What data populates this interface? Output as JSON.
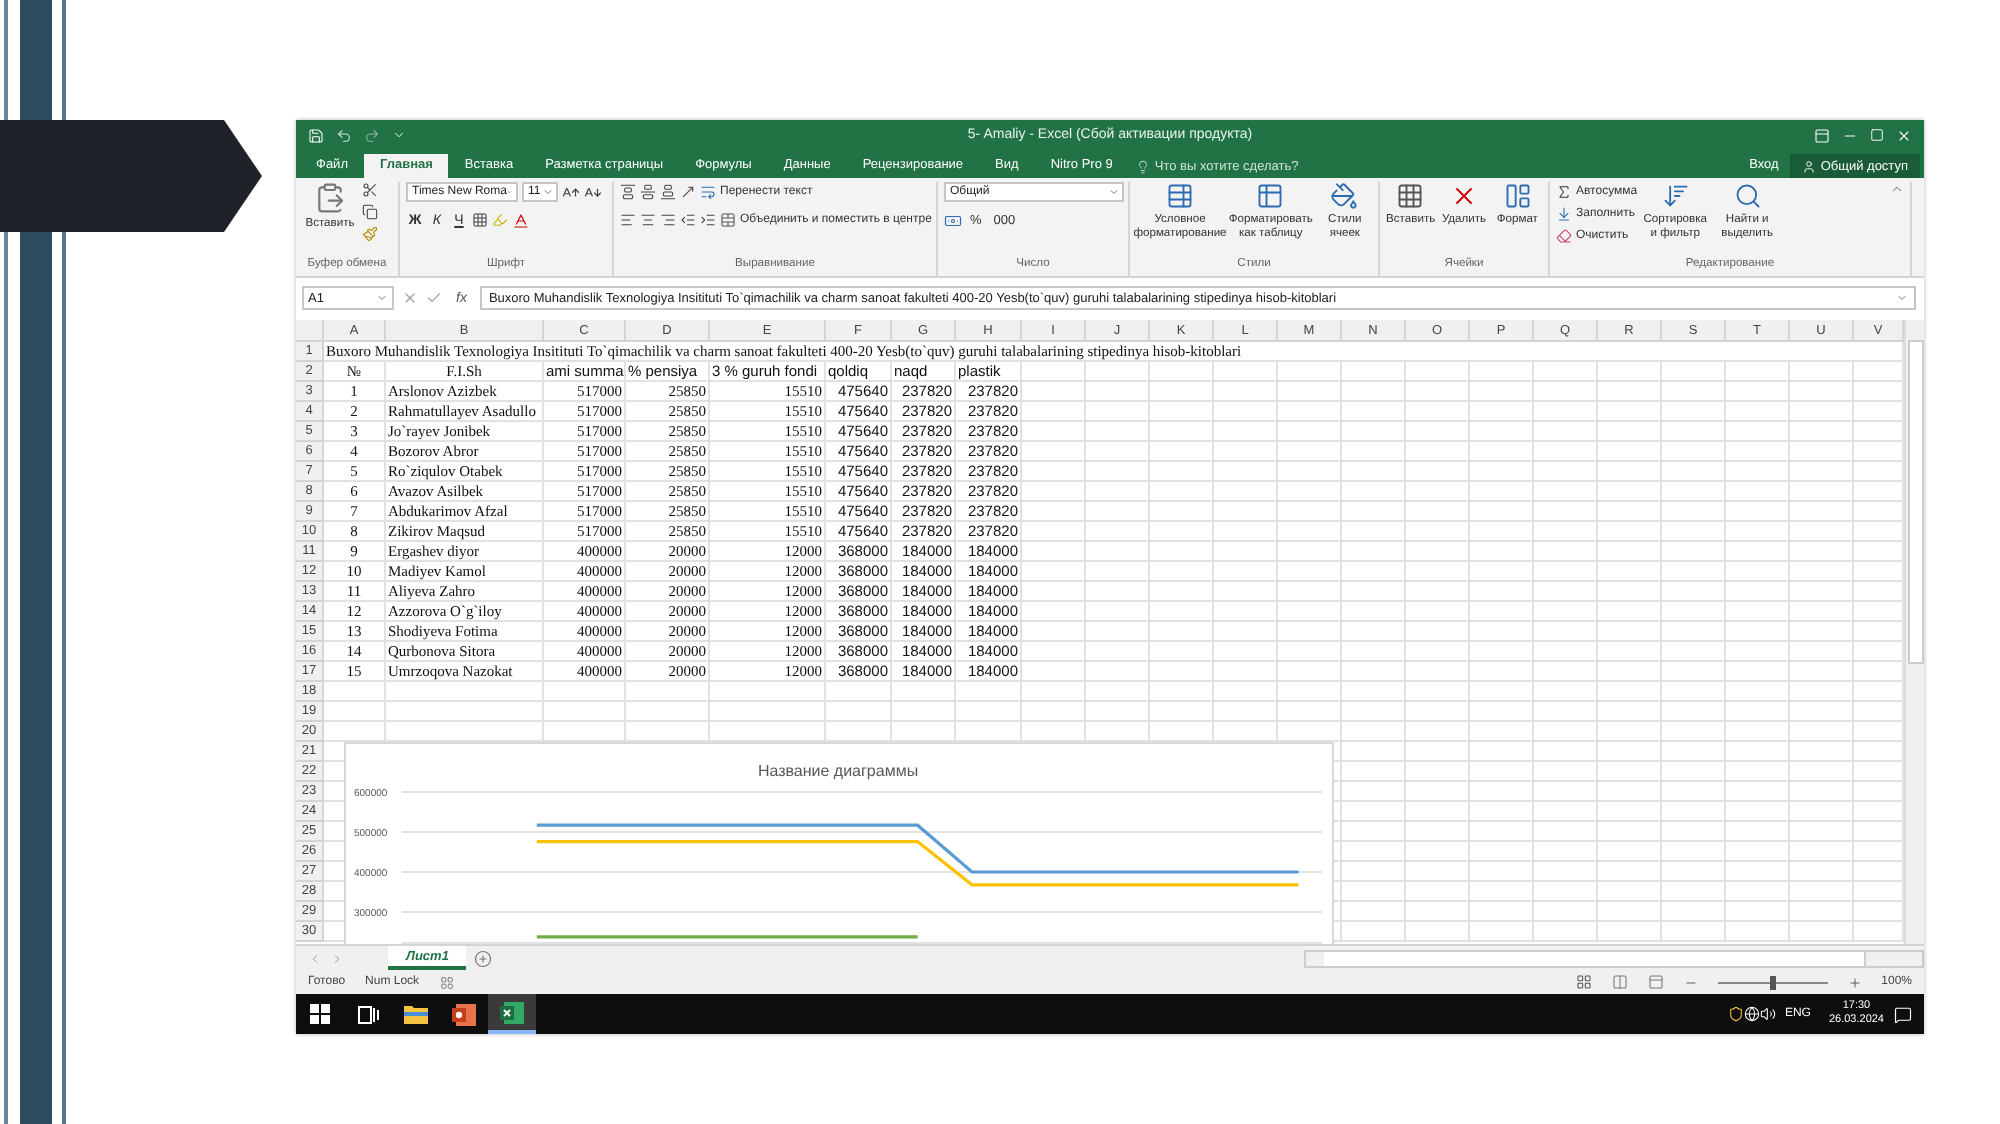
{
  "window": {
    "title": "5- Amaliy - Excel (Сбой активации продукта)"
  },
  "tabs": [
    {
      "label": "Файл",
      "selected": false
    },
    {
      "label": "Главная",
      "selected": true
    },
    {
      "label": "Вставка",
      "selected": false
    },
    {
      "label": "Разметка страницы",
      "selected": false
    },
    {
      "label": "Формулы",
      "selected": false
    },
    {
      "label": "Данные",
      "selected": false
    },
    {
      "label": "Рецензирование",
      "selected": false
    },
    {
      "label": "Вид",
      "selected": false
    },
    {
      "label": "Nitro Pro 9",
      "selected": false
    }
  ],
  "tell_me": {
    "placeholder": "Что вы хотите сделать?"
  },
  "account": {
    "sign_in": "Вход",
    "share": "Общий доступ"
  },
  "ribbon": [
    {
      "kind": "clipboard",
      "label": "Буфер обмена",
      "paste": "Вставить"
    },
    {
      "kind": "font",
      "label": "Шрифт",
      "font": "Times New Roma",
      "size": "11",
      "bold": "Ж",
      "italic": "К",
      "underline": "Ч"
    },
    {
      "kind": "alignment",
      "label": "Выравнивание",
      "wrap": "Перенести текст",
      "merge": "Объединить и поместить в центре"
    },
    {
      "kind": "number",
      "label": "Число",
      "format": "Общий",
      "percent": "%",
      "thousands": "000"
    },
    {
      "kind": "styles",
      "label": "Стили",
      "buttons": [
        "Условное форматирование",
        "Форматировать как таблицу",
        "Стили ячеек"
      ]
    },
    {
      "kind": "cells",
      "label": "Ячейки",
      "buttons": [
        "Вставить",
        "Удалить",
        "Формат"
      ]
    },
    {
      "kind": "editing",
      "label": "Редактирование",
      "small": [
        "Автосумма",
        "Заполнить",
        "Очистить"
      ],
      "large": [
        "Сортировка и фильтр",
        "Найти и выделить"
      ]
    }
  ],
  "formula_bar": {
    "name_box": "A1",
    "function_label": "fx",
    "value": "Buxoro Muhandislik Texnologiya Insitituti To`qimachilik va charm sanoat fakulteti 400-20 Yesb(to`quv) guruhi talabalarining stipedinya hisob-kitoblari"
  },
  "sheet": {
    "columns": [
      "A",
      "B",
      "C",
      "D",
      "E",
      "F",
      "G",
      "H",
      "I",
      "J",
      "K",
      "L",
      "M",
      "N",
      "O",
      "P",
      "Q",
      "R",
      "S",
      "T",
      "U",
      "V"
    ],
    "rows": [
      {
        "number": "1",
        "kind": "title",
        "cells": [
          "Buxoro Muhandislik Texnologiya Insitituti To`qimachilik va charm sanoat fakulteti 400-20 Yesb(to`quv) guruhi talabalarining stipedinya hisob-kitoblari"
        ]
      },
      {
        "number": "2",
        "kind": "header",
        "cells": [
          "№",
          "F.I.Sh",
          "ami summa",
          "% pensiya",
          "3 % guruh fondi",
          "qoldiq",
          "naqd",
          "plastik"
        ]
      },
      {
        "number": "3",
        "kind": "data",
        "cells": [
          "1",
          "Arslonov Azizbek",
          "517000",
          "25850",
          "15510",
          "475640",
          "237820",
          "237820"
        ]
      },
      {
        "number": "4",
        "kind": "data",
        "cells": [
          "2",
          "Rahmatullayev Asadullo",
          "517000",
          "25850",
          "15510",
          "475640",
          "237820",
          "237820"
        ]
      },
      {
        "number": "5",
        "kind": "data",
        "cells": [
          "3",
          "Jo`rayev Jonibek",
          "517000",
          "25850",
          "15510",
          "475640",
          "237820",
          "237820"
        ]
      },
      {
        "number": "6",
        "kind": "data",
        "cells": [
          "4",
          "Bozorov Abror",
          "517000",
          "25850",
          "15510",
          "475640",
          "237820",
          "237820"
        ]
      },
      {
        "number": "7",
        "kind": "data",
        "cells": [
          "5",
          "Ro`ziqulov Otabek",
          "517000",
          "25850",
          "15510",
          "475640",
          "237820",
          "237820"
        ]
      },
      {
        "number": "8",
        "kind": "data",
        "cells": [
          "6",
          "Avazov Asilbek",
          "517000",
          "25850",
          "15510",
          "475640",
          "237820",
          "237820"
        ]
      },
      {
        "number": "9",
        "kind": "data",
        "cells": [
          "7",
          "Abdukarimov Afzal",
          "517000",
          "25850",
          "15510",
          "475640",
          "237820",
          "237820"
        ]
      },
      {
        "number": "10",
        "kind": "data",
        "cells": [
          "8",
          "Zikirov Maqsud",
          "517000",
          "25850",
          "15510",
          "475640",
          "237820",
          "237820"
        ]
      },
      {
        "number": "11",
        "kind": "data",
        "cells": [
          "9",
          "Ergashev diyor",
          "400000",
          "20000",
          "12000",
          "368000",
          "184000",
          "184000"
        ]
      },
      {
        "number": "12",
        "kind": "data",
        "cells": [
          "10",
          "Madiyev Kamol",
          "400000",
          "20000",
          "12000",
          "368000",
          "184000",
          "184000"
        ]
      },
      {
        "number": "13",
        "kind": "data",
        "cells": [
          "11",
          "Aliyeva Zahro",
          "400000",
          "20000",
          "12000",
          "368000",
          "184000",
          "184000"
        ]
      },
      {
        "number": "14",
        "kind": "data",
        "cells": [
          "12",
          "Azzorova O`g`iloy",
          "400000",
          "20000",
          "12000",
          "368000",
          "184000",
          "184000"
        ]
      },
      {
        "number": "15",
        "kind": "data",
        "cells": [
          "13",
          "Shodiyeva Fotima",
          "400000",
          "20000",
          "12000",
          "368000",
          "184000",
          "184000"
        ]
      },
      {
        "number": "16",
        "kind": "data",
        "cells": [
          "14",
          "Qurbonova Sitora",
          "400000",
          "20000",
          "12000",
          "368000",
          "184000",
          "184000"
        ]
      },
      {
        "number": "17",
        "kind": "data",
        "cells": [
          "15",
          "Umrzoqova Nazokat",
          "400000",
          "20000",
          "12000",
          "368000",
          "184000",
          "184000"
        ]
      },
      {
        "number": "18",
        "kind": "empty"
      },
      {
        "number": "19",
        "kind": "empty"
      },
      {
        "number": "20",
        "kind": "empty"
      },
      {
        "number": "21",
        "kind": "empty"
      },
      {
        "number": "22",
        "kind": "empty"
      },
      {
        "number": "23",
        "kind": "empty"
      },
      {
        "number": "24",
        "kind": "empty"
      },
      {
        "number": "25",
        "kind": "empty"
      },
      {
        "number": "26",
        "kind": "empty"
      },
      {
        "number": "27",
        "kind": "empty"
      },
      {
        "number": "28",
        "kind": "empty"
      },
      {
        "number": "29",
        "kind": "empty"
      },
      {
        "number": "30",
        "kind": "empty"
      }
    ],
    "chart": {
      "chart_data": {
        "type": "line",
        "title": "Название диаграммы",
        "grid": true,
        "ylim": [
          220000,
          600000
        ],
        "yticks": [
          300000,
          400000,
          500000,
          600000
        ],
        "series": [
          {
            "color": "#5b9bd5",
            "values": [
              null,
              null,
              517000,
              517000,
              517000,
              517000,
              517000,
              517000,
              517000,
              517000,
              400000,
              400000,
              400000,
              400000,
              400000,
              400000,
              400000
            ]
          },
          {
            "color": "#ffc000",
            "values": [
              null,
              null,
              476000,
              476000,
              476000,
              476000,
              476000,
              476000,
              476000,
              476000,
              368000,
              368000,
              368000,
              368000,
              368000,
              368000,
              368000
            ]
          },
          {
            "color": "#70ad47",
            "values": [
              null,
              null,
              238000,
              238000,
              238000,
              238000,
              238000,
              238000,
              238000,
              238000,
              null,
              null,
              null,
              null,
              null,
              null,
              null
            ]
          }
        ]
      }
    }
  },
  "sheet_tabs": [
    {
      "label": "Лист1",
      "selected": true
    }
  ],
  "status_bar": {
    "items": [
      "Готово",
      "Num Lock"
    ],
    "zoom": {
      "level": 0.5,
      "reading": "100%"
    }
  },
  "taskbar": {
    "apps": [
      {
        "kind": "explorer",
        "active": false
      },
      {
        "kind": "powerpoint",
        "active": false
      },
      {
        "kind": "excel",
        "active": true
      }
    ],
    "language": "ENG",
    "time": "17:30",
    "date": "26.03.2024"
  }
}
